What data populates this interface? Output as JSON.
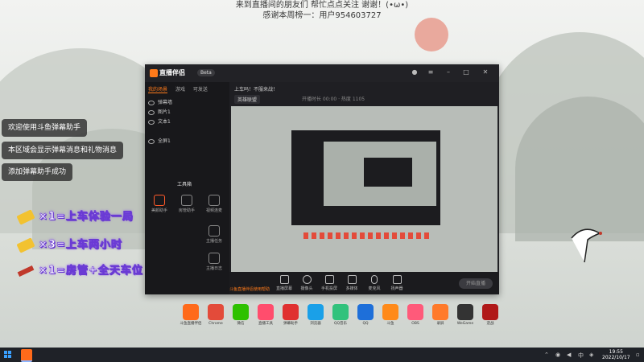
{
  "banner": {
    "line1": "来到直播间的朋友们 帮忙点点关注 谢谢！(•ω•)",
    "line2": "感谢本周榜一：用户954603727"
  },
  "notifications": [
    "欢迎使用斗鱼弹幕助手",
    "本区域会显示弹幕消息和礼物消息",
    "添加弹幕助手成功"
  ],
  "gift_rules": [
    {
      "text": "×1=上车体验一局",
      "icon": "gift-bar-icon",
      "color": "#f2c230"
    },
    {
      "text": "×3=上车两小时",
      "icon": "gift-box-icon",
      "color": "#f2c230"
    },
    {
      "text": "×1=房管+全天车位",
      "icon": "plane-icon",
      "color": "#c0392b"
    }
  ],
  "app": {
    "name": "直播伴侣",
    "badge": "Beta",
    "tabs": [
      "我的场景",
      "游戏",
      "可发送"
    ],
    "layers": [
      "弹幕墙",
      "图片1",
      "文本1",
      "全屏1"
    ],
    "tools_title": "工具箱",
    "tools": [
      "美颜助手",
      "房管助手",
      "视频连麦",
      "主播任务",
      "",
      "主播日志"
    ],
    "title_text": "上车吗！不服来战！",
    "category": "英雄联盟",
    "meta": "开播时长 00:00 · 热度 1105",
    "bottom_buttons": [
      "直播屏幕",
      "摄像头",
      "手机投屏",
      "多媒体",
      "麦克风",
      "扬声器"
    ],
    "start_label": "开始直播",
    "status": "斗鱼直播伴侣使用帮助"
  },
  "desktop_icons": [
    {
      "label": "斗鱼直播伴侣",
      "color": "#ff6a1a"
    },
    {
      "label": "Chrome",
      "color": "#e34b3a"
    },
    {
      "label": "微信",
      "color": "#2dc100"
    },
    {
      "label": "直播工具",
      "color": "#ff4d6d"
    },
    {
      "label": "弹幕助手",
      "color": "#e03030"
    },
    {
      "label": "浏览器",
      "color": "#1aa0e8"
    },
    {
      "label": "QQ音乐",
      "color": "#31c27c"
    },
    {
      "label": "QQ",
      "color": "#1e6fd9"
    },
    {
      "label": "斗鱼",
      "color": "#ff8a1a"
    },
    {
      "label": "OBS",
      "color": "#ff5a7a"
    },
    {
      "label": "录屏",
      "color": "#ff7a2a"
    },
    {
      "label": "WeGame",
      "color": "#333333"
    },
    {
      "label": "逆战",
      "color": "#b01818"
    }
  ],
  "taskbar": {
    "time": "19:55",
    "date": "2022/10/17"
  }
}
